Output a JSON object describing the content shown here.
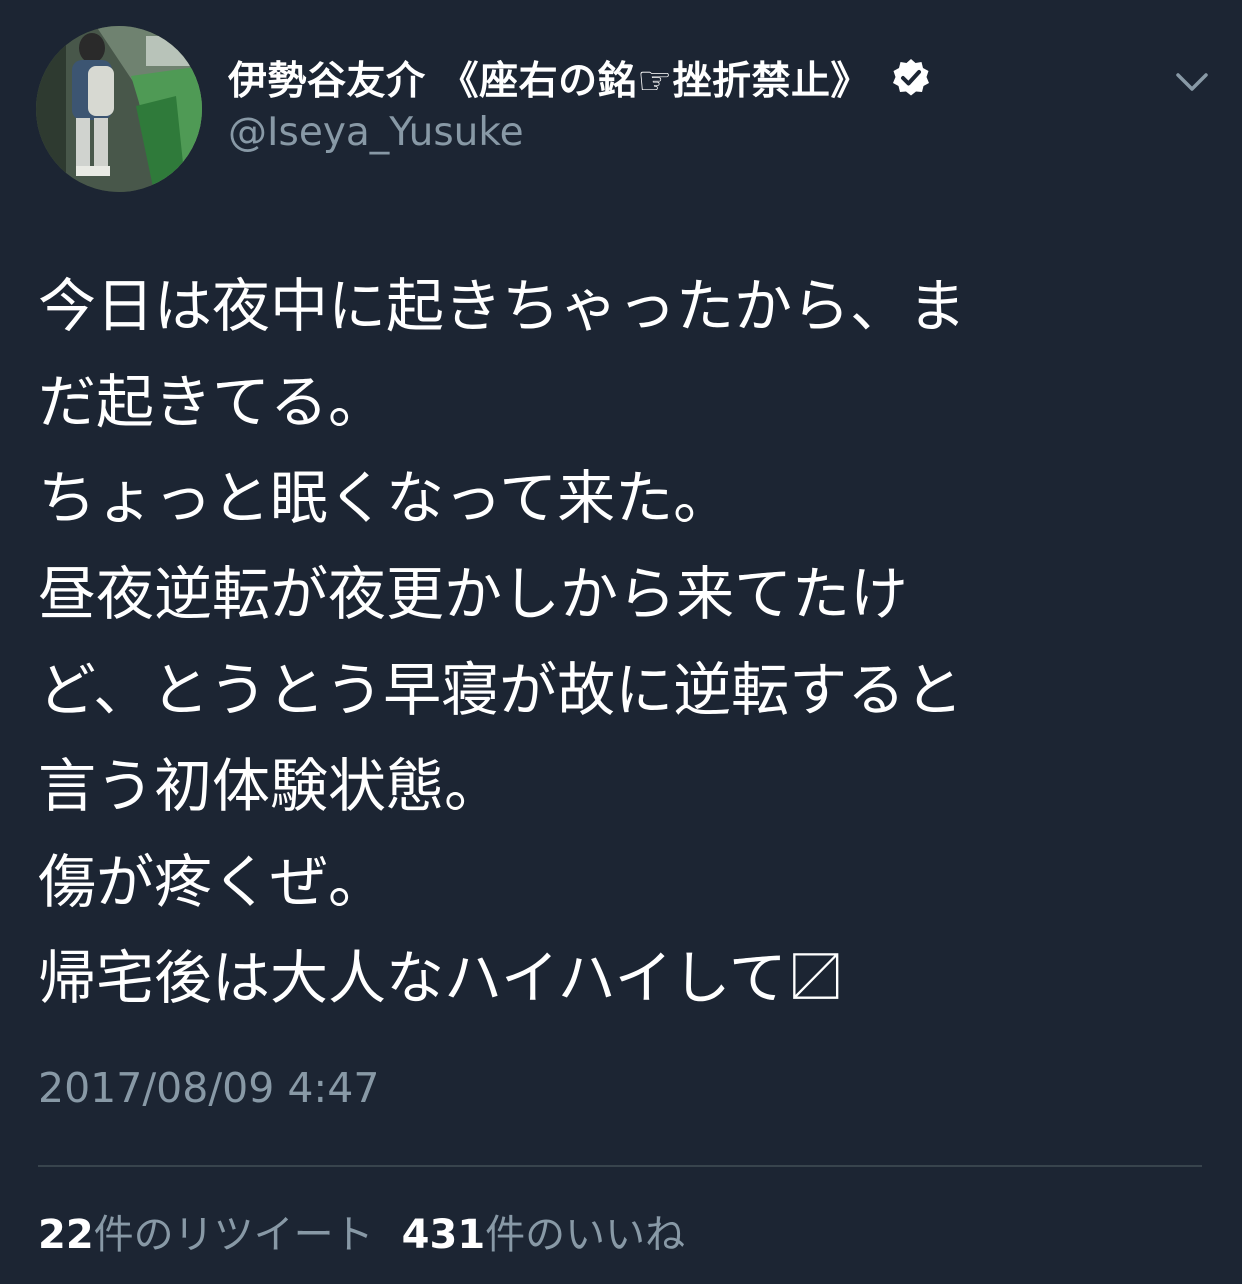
{
  "user": {
    "display_name": "伊勢谷友介 《座右の銘☞挫折禁止》",
    "handle": "@Iseya_Yusuke",
    "verified": true,
    "avatar_icon": "profile-photo"
  },
  "tweet": {
    "text": "今日は夜中に起きちゃったから、ま\nだ起きてる。\nちょっと眠くなって来た。\n昼夜逆転が夜更かしから来てたけ\nど、とうとう早寝が故に逆転すると\n言う初体験状態。\n傷が疼くぜ。\n帰宅後は大人なハイハイして〼",
    "timestamp": "2017/08/09 4:47"
  },
  "stats": {
    "retweets_count": "22",
    "retweets_label": "件のリツイート",
    "likes_count": "431",
    "likes_label": "件のいいね"
  },
  "colors": {
    "background": "#1c2533",
    "text": "#ffffff",
    "secondary": "#8899a6",
    "divider": "#38444d"
  }
}
